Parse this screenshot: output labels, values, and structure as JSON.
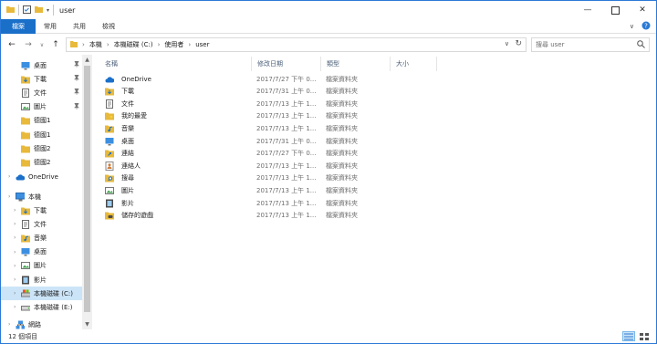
{
  "window": {
    "title": "user"
  },
  "ribbon": {
    "tabs": [
      "檔案",
      "常用",
      "共用",
      "檢視"
    ]
  },
  "address": {
    "segments": [
      "本機",
      "本機磁碟 (C:)",
      "使用者",
      "user"
    ]
  },
  "search": {
    "placeholder": "搜尋 user"
  },
  "sidebar": {
    "quick_access": [
      {
        "label": "桌面",
        "icon": "desktop-icon",
        "pinned": true
      },
      {
        "label": "下載",
        "icon": "download-icon",
        "pinned": true
      },
      {
        "label": "文件",
        "icon": "document-icon",
        "pinned": true
      },
      {
        "label": "圖片",
        "icon": "picture-icon",
        "pinned": true
      },
      {
        "label": "德國1",
        "icon": "folder-icon",
        "pinned": false
      },
      {
        "label": "德國1",
        "icon": "folder-icon",
        "pinned": false
      },
      {
        "label": "德國2",
        "icon": "folder-icon",
        "pinned": false
      },
      {
        "label": "德國2",
        "icon": "folder-icon",
        "pinned": false
      }
    ],
    "onedrive": "OneDrive",
    "this_pc": "本機",
    "pc_items": [
      {
        "label": "下載",
        "icon": "download-icon"
      },
      {
        "label": "文件",
        "icon": "document-icon"
      },
      {
        "label": "音樂",
        "icon": "music-icon"
      },
      {
        "label": "桌面",
        "icon": "desktop-icon"
      },
      {
        "label": "圖片",
        "icon": "picture-icon"
      },
      {
        "label": "影片",
        "icon": "video-icon"
      },
      {
        "label": "本機磁碟 (C:)",
        "icon": "drive-c-icon",
        "selected": true
      },
      {
        "label": "本機磁碟 (E:)",
        "icon": "drive-icon"
      }
    ],
    "network": "網路"
  },
  "columns": {
    "name": "名稱",
    "date": "修改日期",
    "type": "類型",
    "size": "大小"
  },
  "files": [
    {
      "name": "OneDrive",
      "date": "2017/7/27 下午 0...",
      "type": "檔案資料夾",
      "icon": "onedrive-icon"
    },
    {
      "name": "下載",
      "date": "2017/7/31 上午 0...",
      "type": "檔案資料夾",
      "icon": "download-icon"
    },
    {
      "name": "文件",
      "date": "2017/7/13 上午 1...",
      "type": "檔案資料夾",
      "icon": "document-icon"
    },
    {
      "name": "我的最愛",
      "date": "2017/7/13 上午 1...",
      "type": "檔案資料夾",
      "icon": "favorites-icon"
    },
    {
      "name": "音樂",
      "date": "2017/7/13 上午 1...",
      "type": "檔案資料夾",
      "icon": "music-icon"
    },
    {
      "name": "桌面",
      "date": "2017/7/31 上午 0...",
      "type": "檔案資料夾",
      "icon": "desktop-icon"
    },
    {
      "name": "連結",
      "date": "2017/7/27 下午 0...",
      "type": "檔案資料夾",
      "icon": "links-icon"
    },
    {
      "name": "連絡人",
      "date": "2017/7/13 上午 1...",
      "type": "檔案資料夾",
      "icon": "contacts-icon"
    },
    {
      "name": "搜尋",
      "date": "2017/7/13 上午 1...",
      "type": "檔案資料夾",
      "icon": "search-folder-icon"
    },
    {
      "name": "圖片",
      "date": "2017/7/13 上午 1...",
      "type": "檔案資料夾",
      "icon": "picture-icon"
    },
    {
      "name": "影片",
      "date": "2017/7/13 上午 1...",
      "type": "檔案資料夾",
      "icon": "video-icon"
    },
    {
      "name": "儲存的遊戲",
      "date": "2017/7/13 上午 1...",
      "type": "檔案資料夾",
      "icon": "saved-games-icon"
    }
  ],
  "status": {
    "count": "12 個項目"
  },
  "colors": {
    "accent": "#1a6fc9",
    "folder": "#e8b93a",
    "selection": "#cce4f7"
  }
}
